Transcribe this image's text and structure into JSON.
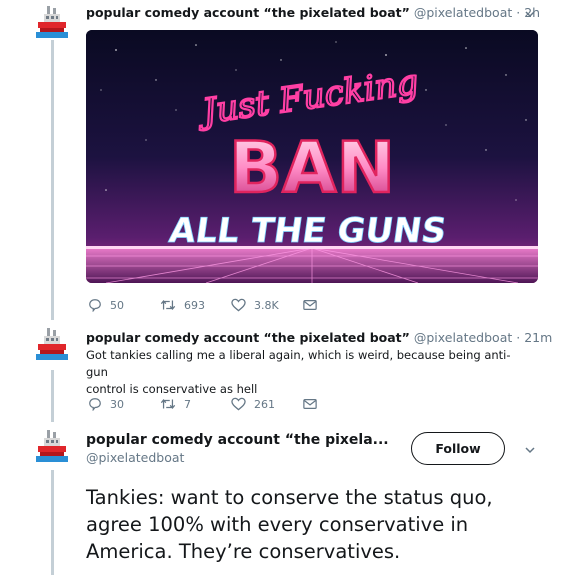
{
  "tweet1": {
    "name": "popular comedy account “the pixelated boat”",
    "handle": "@pixelatedboat",
    "time": "· 2h",
    "image_text": {
      "line1": "Just Fucking",
      "line2": "BAN",
      "line3": "ALL THE GUNS"
    },
    "replies": "50",
    "retweets": "693",
    "likes": "3.8K"
  },
  "tweet2": {
    "name": "popular comedy account “the pixelated boat”",
    "handle": "@pixelatedboat",
    "time": "· 21m",
    "text_line1": "Got tankies calling me a liberal again, which is weird, because being anti-gun",
    "text_line2": "control is conservative as hell",
    "replies": "30",
    "retweets": "7",
    "likes": "261"
  },
  "tweet3": {
    "name": "popular comedy account “the pixela...",
    "handle": "@pixelatedboat",
    "follow_label": "Follow",
    "text_line1": "Tankies: want to conserve the status quo,",
    "text_line2": "agree 100% with every conservative in",
    "text_line3": "America. They’re conservatives."
  },
  "colors": {
    "name": "#14171a",
    "secondary": "#657786",
    "thread_line": "#c4cfd6",
    "neon_pink": "#ff3fa4",
    "neon_blue": "#7fd3ff"
  },
  "icons": [
    "avatar-boat-icon",
    "chevron-down-icon",
    "reply-icon",
    "retweet-icon",
    "like-icon",
    "message-icon"
  ]
}
